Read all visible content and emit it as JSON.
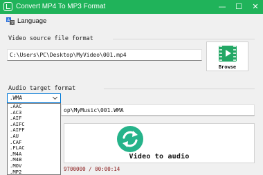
{
  "window": {
    "title": "Convert MP4 To MP3 Format",
    "minimize": "—",
    "maximize": "☐",
    "close": "✕"
  },
  "toolbar": {
    "language_label": "Language"
  },
  "source": {
    "section_label": "Video source file format",
    "path": "C:\\Users\\PC\\Desktop\\MyVideo\\001.mp4",
    "browse_label": "Browse"
  },
  "target": {
    "section_label": "Audio target format",
    "selected_format": ".WMA",
    "output_path_visible": "op\\MyMusic\\001.WMA",
    "format_options": [
      ".AAC",
      ".AC3",
      ".AIF",
      ".AIFC",
      ".AIFF",
      ".AU",
      ".CAF",
      ".FLAC",
      ".M4A",
      ".M4B",
      ".MOV",
      ".MP2"
    ]
  },
  "convert": {
    "label": "Video to audio"
  },
  "status": {
    "progress_text": "9700000 / 00:00:14"
  },
  "colors": {
    "titlebar": "#20b35a",
    "accent": "#0078d7",
    "convert_icon": "#26b38a",
    "browse_icon": "#23a765",
    "status_text": "#8b1a1a"
  }
}
